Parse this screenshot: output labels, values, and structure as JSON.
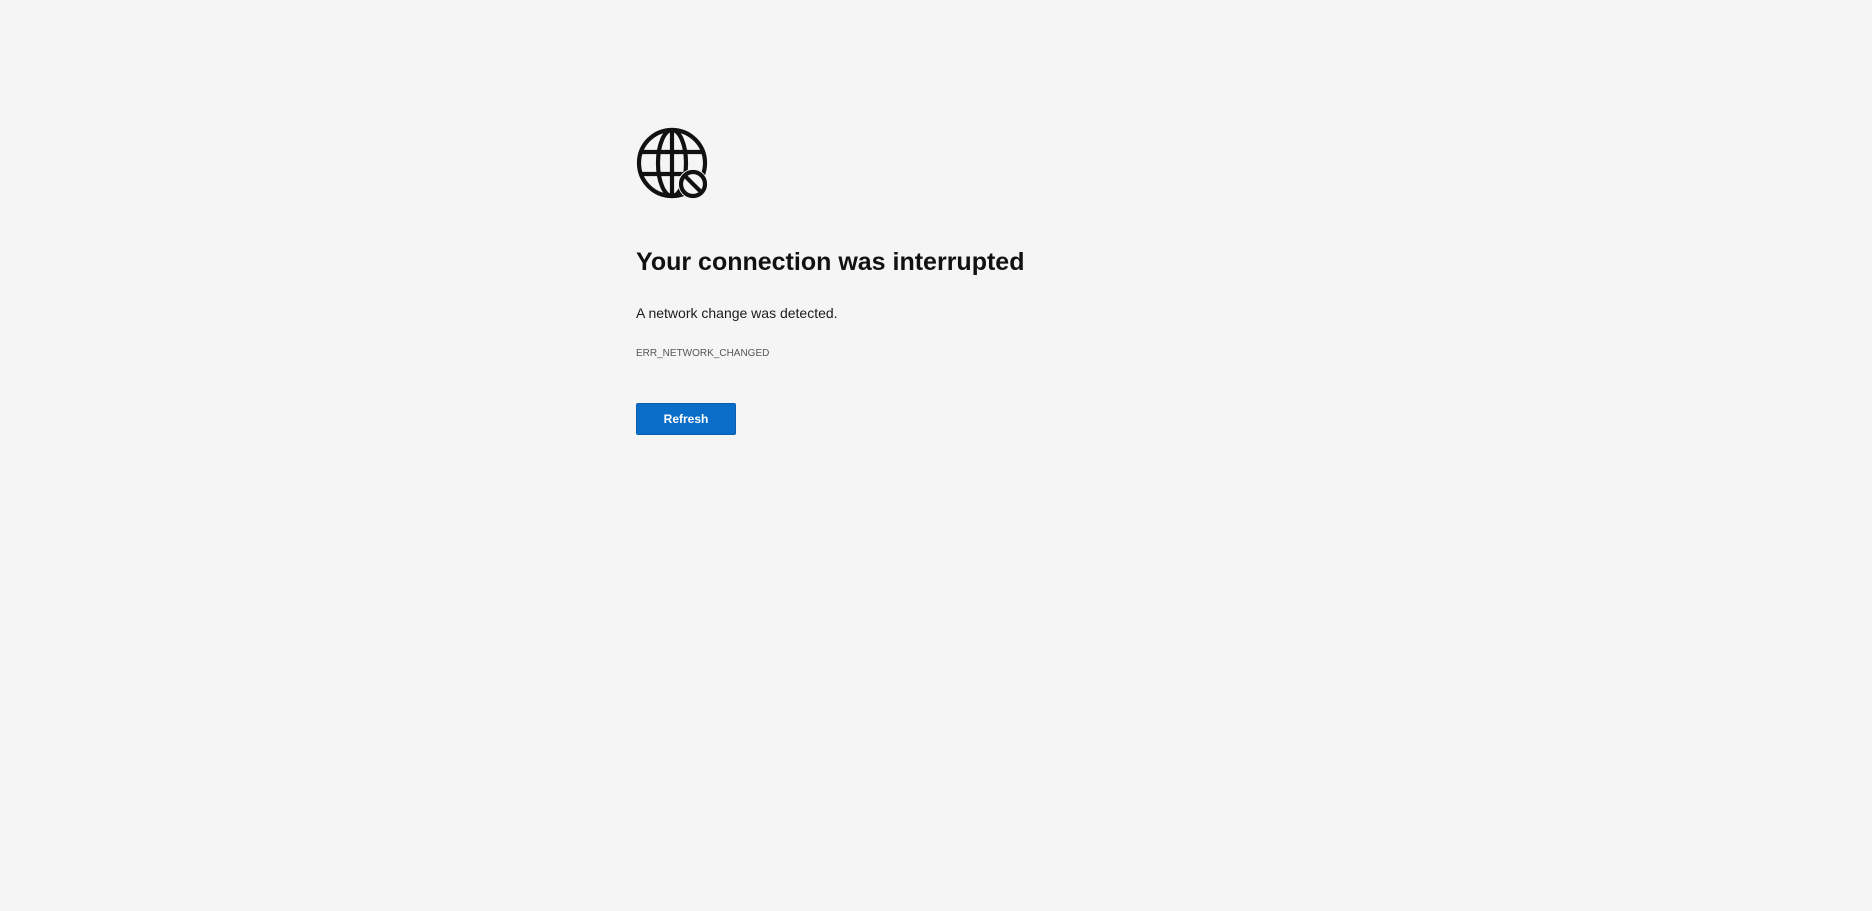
{
  "error_page": {
    "icon": "globe-blocked-icon",
    "title": "Your connection was interrupted",
    "message": "A network change was detected.",
    "error_code": "ERR_NETWORK_CHANGED",
    "refresh_label": "Refresh"
  },
  "colors": {
    "background": "#f5f5f5",
    "button": "#0a6ec9",
    "title": "#111111"
  }
}
